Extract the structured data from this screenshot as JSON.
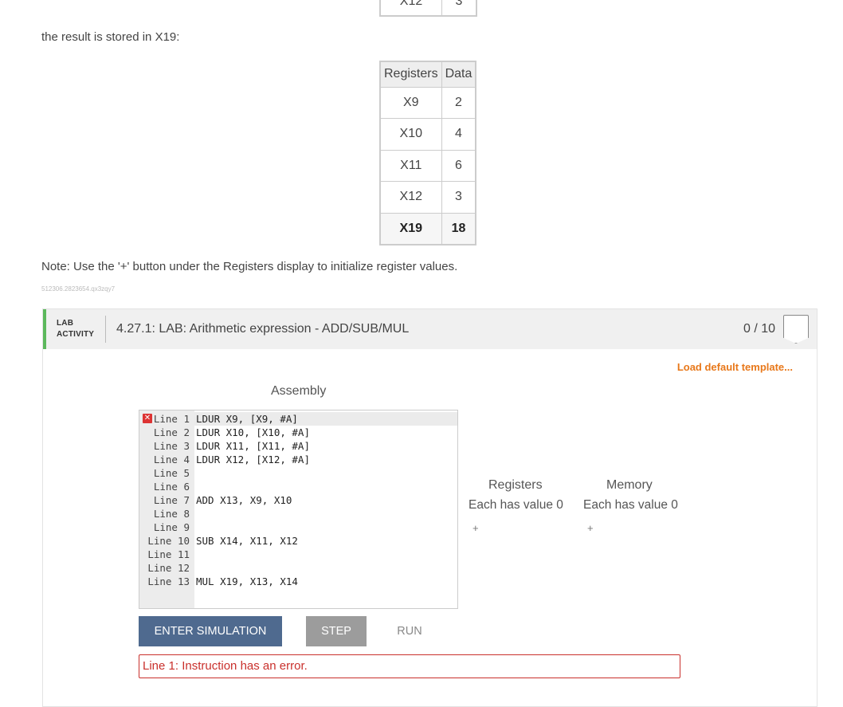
{
  "top_table": {
    "register": "X12",
    "value": "3"
  },
  "intro_text": "the result is stored in X19:",
  "register_table": {
    "headers": [
      "Registers",
      "Data"
    ],
    "rows": [
      {
        "reg": "X9",
        "val": "2"
      },
      {
        "reg": "X10",
        "val": "4"
      },
      {
        "reg": "X11",
        "val": "6"
      },
      {
        "reg": "X12",
        "val": "3"
      },
      {
        "reg": "X19",
        "val": "18"
      }
    ]
  },
  "note": "Note: Use the '+' button under the Registers display to initialize register values.",
  "tiny_id": "512306.2823654.qx3zqy7",
  "lab": {
    "tag_line1": "LAB",
    "tag_line2": "ACTIVITY",
    "title": "4.27.1: LAB: Arithmetic expression - ADD/SUB/MUL",
    "score": "0 / 10",
    "load_template": "Load default template..."
  },
  "assembly": {
    "title": "Assembly",
    "lines": [
      {
        "label": "Line 1",
        "code": "LDUR X9, [X9, #A]"
      },
      {
        "label": "Line 2",
        "code": "LDUR X10, [X10, #A]"
      },
      {
        "label": "Line 3",
        "code": "LDUR X11, [X11, #A]"
      },
      {
        "label": "Line 4",
        "code": "LDUR X12, [X12, #A]"
      },
      {
        "label": "Line 5",
        "code": ""
      },
      {
        "label": "Line 6",
        "code": ""
      },
      {
        "label": "Line 7",
        "code": "ADD X13, X9, X10"
      },
      {
        "label": "Line 8",
        "code": ""
      },
      {
        "label": "Line 9",
        "code": ""
      },
      {
        "label": "Line 10",
        "code": "SUB X14, X11, X12"
      },
      {
        "label": "Line 11",
        "code": ""
      },
      {
        "label": "Line 12",
        "code": ""
      },
      {
        "label": "Line 13",
        "code": "MUL X19, X13, X14"
      }
    ]
  },
  "registers_panel": {
    "title": "Registers",
    "subtitle": "Each has value 0",
    "add": "+"
  },
  "memory_panel": {
    "title": "Memory",
    "subtitle": "Each has value 0",
    "add": "+"
  },
  "buttons": {
    "enter": "ENTER SIMULATION",
    "step": "STEP",
    "run": "RUN"
  },
  "error_message": "Line 1: Instruction has an error.",
  "error_icon": "✕"
}
